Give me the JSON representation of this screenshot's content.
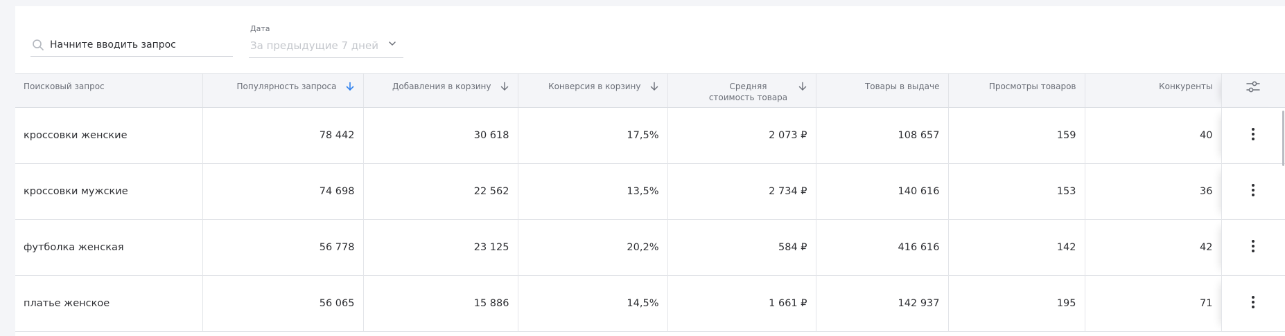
{
  "search": {
    "placeholder": "Начните вводить запрос"
  },
  "date_filter": {
    "label": "Дата",
    "value": "За предыдущие 7 дней"
  },
  "colors": {
    "accent": "#2f80ed",
    "header_bg": "#f4f5f8",
    "text": "#2e2f33",
    "muted": "#6a6e77",
    "placeholder": "#c4c7cc"
  },
  "table": {
    "columns": [
      {
        "label": "Поисковый запрос",
        "sort": false
      },
      {
        "label": "Популярность запроса",
        "sort": "active"
      },
      {
        "label": "Добавления в корзину",
        "sort": "inactive"
      },
      {
        "label": "Конверсия в корзину",
        "sort": "inactive"
      },
      {
        "label": "Средняя стоимость товара",
        "sort": "inactive"
      },
      {
        "label": "Товары в выдаче",
        "sort": false
      },
      {
        "label": "Просмотры товаров",
        "sort": false
      },
      {
        "label": "Конкуренты",
        "sort": false
      }
    ],
    "settings_icon": "sliders-icon",
    "row_menu_icon": "more-vertical-icon",
    "rows": [
      [
        "кроссовки женские",
        "78 442",
        "30 618",
        "17,5%",
        "2 073 ₽",
        "108 657",
        "159",
        "40"
      ],
      [
        "кроссовки мужские",
        "74 698",
        "22 562",
        "13,5%",
        "2 734 ₽",
        "140 616",
        "153",
        "36"
      ],
      [
        "футболка женская",
        "56 778",
        "23 125",
        "20,2%",
        "584 ₽",
        "416 616",
        "142",
        "42"
      ],
      [
        "платье женское",
        "56 065",
        "15 886",
        "14,5%",
        "1 661 ₽",
        "142 937",
        "195",
        "71"
      ]
    ]
  }
}
